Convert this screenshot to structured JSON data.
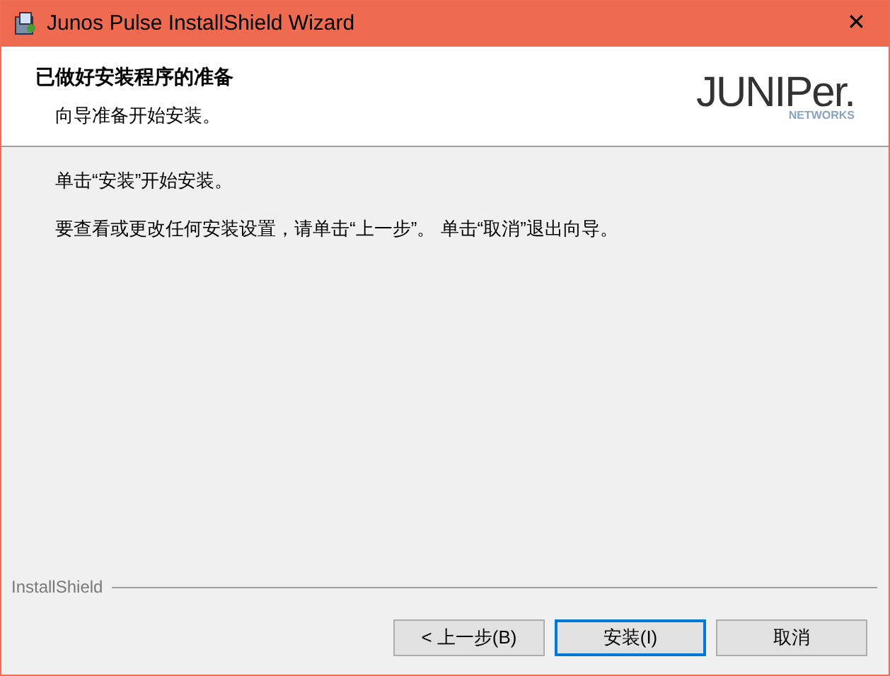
{
  "window": {
    "title": "Junos Pulse InstallShield Wizard",
    "close": "✕"
  },
  "header": {
    "title": "已做好安装程序的准备",
    "subtitle": "向导准备开始安装。",
    "logo": {
      "name": "JUNIPer.",
      "tagline": "NETWORKS"
    }
  },
  "body": [
    "单击“安装”开始安装。",
    "要查看或更改任何安装设置，请单击“上一步”。 单击“取消”退出向导。"
  ],
  "footer": {
    "brand": "InstallShield"
  },
  "buttons": [
    {
      "label": "< 上一步(B)",
      "default": false
    },
    {
      "label": "安装(I)",
      "default": true
    },
    {
      "label": "取消",
      "default": false
    }
  ]
}
